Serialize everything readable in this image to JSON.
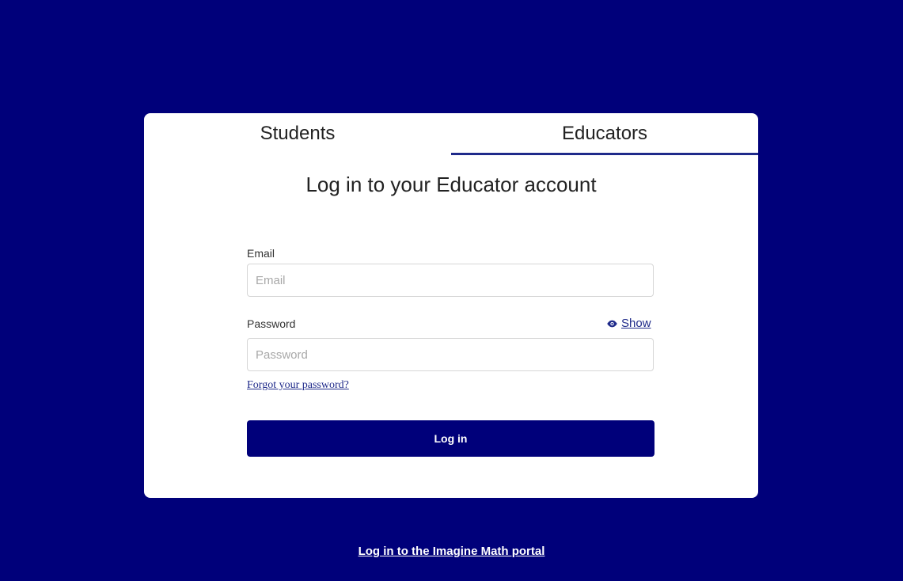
{
  "tabs": {
    "students": "Students",
    "educators": "Educators",
    "active": "educators"
  },
  "form": {
    "heading": "Log in to your Educator account",
    "email_label": "Email",
    "email_placeholder": "Email",
    "email_value": "",
    "password_label": "Password",
    "password_placeholder": "Password",
    "password_value": "",
    "show_label": "Show",
    "forgot_label": "Forgot your password?",
    "login_button": "Log in"
  },
  "footer": {
    "portal_link": "Log in to the Imagine Math portal"
  },
  "icons": {
    "show": "eye-icon"
  },
  "colors": {
    "background": "#00007a",
    "card": "#ffffff",
    "accent": "#1f2a8a",
    "button": "#00007a"
  }
}
